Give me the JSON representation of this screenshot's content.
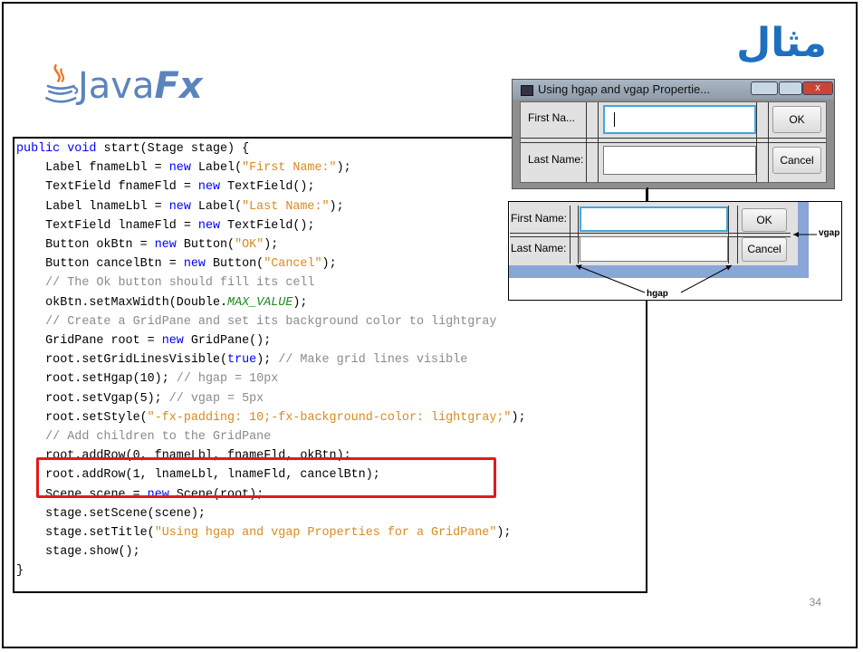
{
  "slide": {
    "title_arabic": "مثال",
    "page_number": "34"
  },
  "logo": {
    "text_main": "Java",
    "text_fx": "Fx"
  },
  "code": {
    "lines": [
      [
        {
          "t": "kw",
          "v": "public void"
        },
        {
          "t": "n",
          "v": " start(Stage stage) {"
        }
      ],
      [
        {
          "t": "n",
          "v": "    Label fnameLbl = "
        },
        {
          "t": "kw",
          "v": "new"
        },
        {
          "t": "n",
          "v": " Label("
        },
        {
          "t": "str",
          "v": "\"First Name:\""
        },
        {
          "t": "n",
          "v": ");"
        }
      ],
      [
        {
          "t": "n",
          "v": "    TextField fnameFld = "
        },
        {
          "t": "kw",
          "v": "new"
        },
        {
          "t": "n",
          "v": " TextField();"
        }
      ],
      [
        {
          "t": "n",
          "v": "    Label lnameLbl = "
        },
        {
          "t": "kw",
          "v": "new"
        },
        {
          "t": "n",
          "v": " Label("
        },
        {
          "t": "str",
          "v": "\"Last Name:\""
        },
        {
          "t": "n",
          "v": ");"
        }
      ],
      [
        {
          "t": "n",
          "v": "    TextField lnameFld = "
        },
        {
          "t": "kw",
          "v": "new"
        },
        {
          "t": "n",
          "v": " TextField();"
        }
      ],
      [
        {
          "t": "n",
          "v": "    Button okBtn = "
        },
        {
          "t": "kw",
          "v": "new"
        },
        {
          "t": "n",
          "v": " Button("
        },
        {
          "t": "str",
          "v": "\"OK\""
        },
        {
          "t": "n",
          "v": ");"
        }
      ],
      [
        {
          "t": "n",
          "v": "    Button cancelBtn = "
        },
        {
          "t": "kw",
          "v": "new"
        },
        {
          "t": "n",
          "v": " Button("
        },
        {
          "t": "str",
          "v": "\"Cancel\""
        },
        {
          "t": "n",
          "v": ");"
        }
      ],
      [
        {
          "t": "com",
          "v": "    // The Ok button should fill its cell"
        }
      ],
      [
        {
          "t": "n",
          "v": "    okBtn.setMaxWidth(Double."
        },
        {
          "t": "cst",
          "v": "MAX_VALUE"
        },
        {
          "t": "n",
          "v": ");"
        }
      ],
      [
        {
          "t": "com",
          "v": "    // Create a GridPane and set its background color to lightgray"
        }
      ],
      [
        {
          "t": "n",
          "v": "    GridPane root = "
        },
        {
          "t": "kw",
          "v": "new"
        },
        {
          "t": "n",
          "v": " GridPane();"
        }
      ],
      [
        {
          "t": "n",
          "v": "    root.setGridLinesVisible("
        },
        {
          "t": "kw",
          "v": "true"
        },
        {
          "t": "n",
          "v": "); "
        },
        {
          "t": "com",
          "v": "// Make grid lines visible"
        }
      ],
      [
        {
          "t": "n",
          "v": "    root.setHgap(10); "
        },
        {
          "t": "com",
          "v": "// hgap = 10px"
        }
      ],
      [
        {
          "t": "n",
          "v": "    root.setVgap(5); "
        },
        {
          "t": "com",
          "v": "// vgap = 5px"
        }
      ],
      [
        {
          "t": "n",
          "v": "    root.setStyle("
        },
        {
          "t": "str",
          "v": "\"-fx-padding: 10;-fx-background-color: lightgray;\""
        },
        {
          "t": "n",
          "v": ");"
        }
      ],
      [
        {
          "t": "com",
          "v": "    // Add children to the GridPane"
        }
      ],
      [
        {
          "t": "n",
          "v": "    root.addRow(0, fnameLbl, fnameFld, okBtn);"
        }
      ],
      [
        {
          "t": "n",
          "v": "    root.addRow(1, lnameLbl, lnameFld, cancelBtn);"
        }
      ],
      [
        {
          "t": "n",
          "v": "    Scene scene = "
        },
        {
          "t": "kw",
          "v": "new"
        },
        {
          "t": "n",
          "v": " Scene(root);"
        }
      ],
      [
        {
          "t": "n",
          "v": "    stage.setScene(scene);"
        }
      ],
      [
        {
          "t": "n",
          "v": "    stage.setTitle("
        },
        {
          "t": "str",
          "v": "\"Using hgap and vgap Properties for a GridPane\""
        },
        {
          "t": "n",
          "v": ");"
        }
      ],
      [
        {
          "t": "n",
          "v": "    stage.show();"
        }
      ],
      [
        {
          "t": "n",
          "v": "}"
        }
      ]
    ]
  },
  "window": {
    "title": "Using hgap and vgap Propertie...",
    "close_glyph": "x",
    "row1_label": "First Na...",
    "row2_label": "Last Name:",
    "ok_label": "OK",
    "cancel_label": "Cancel"
  },
  "diagram": {
    "row1_label": "First Name:",
    "row2_label": "Last Name:",
    "ok_label": "OK",
    "cancel_label": "Cancel",
    "vgap_label": "vgap",
    "hgap_label": "hgap"
  },
  "colors": {
    "keyword": "#0000ff",
    "string": "#d98a1f",
    "comment": "#8a8a8a",
    "highlight_box": "#e11b1b",
    "title_blue": "#1f6fbf"
  }
}
